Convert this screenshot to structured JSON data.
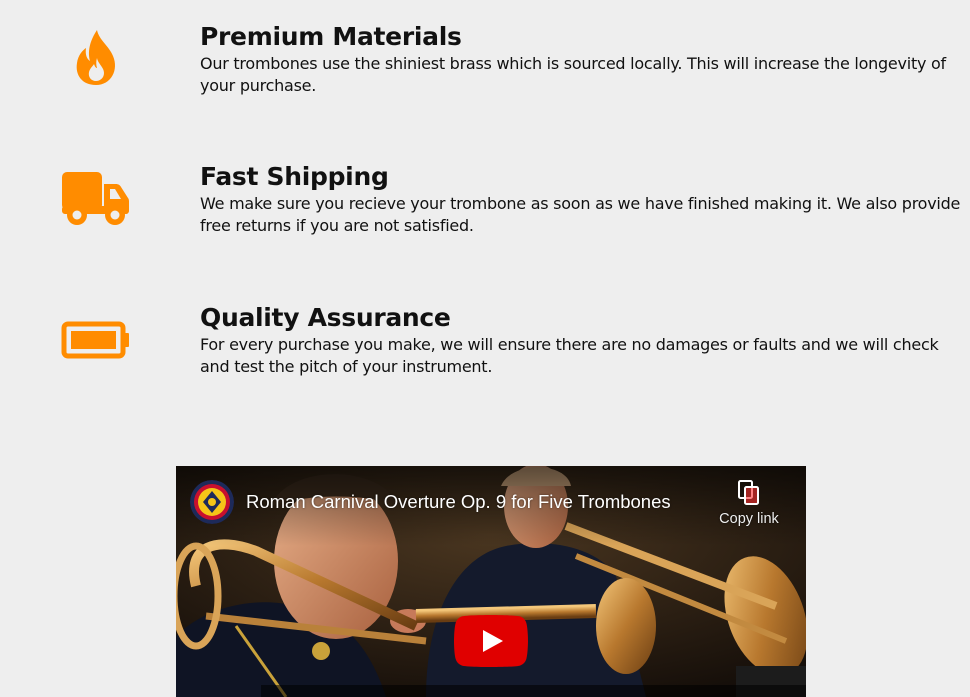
{
  "colors": {
    "accent": "#ff8c00",
    "background": "#eeeeee",
    "text": "#111111",
    "play_button": "#e00000"
  },
  "features": [
    {
      "icon": "fire-icon",
      "title": "Premium Materials",
      "description": "Our trombones use the shiniest brass which is sourced locally. This will increase the longevity of your purchase."
    },
    {
      "icon": "truck-icon",
      "title": "Fast Shipping",
      "description": "We make sure you recieve your trombone as soon as we have finished making it. We also provide free returns if you are not satisfied."
    },
    {
      "icon": "battery-icon",
      "title": "Quality Assurance",
      "description": "For every purchase you make, we will ensure there are no damages or faults and we will check and test the pitch of your instrument."
    }
  ],
  "video": {
    "title": "Roman Carnival Overture Op. 9 for Five Trombones",
    "copy_link_label": "Copy link",
    "channel_avatar_icon": "channel-emblem-icon",
    "play_icon": "play-icon"
  }
}
